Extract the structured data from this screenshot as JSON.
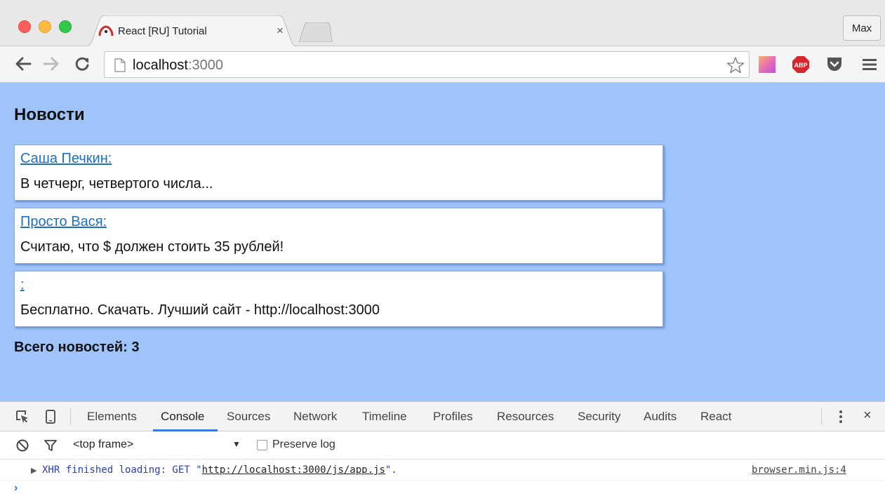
{
  "browser": {
    "tab": {
      "title": "React [RU] Tutorial",
      "close_glyph": "×"
    },
    "profile_name": "Max",
    "address": {
      "host": "localhost",
      "port": ":3000"
    }
  },
  "page": {
    "heading": "Новости",
    "articles": [
      {
        "author": "Саша Печкин:",
        "text": "В четчерг, четвертого числа..."
      },
      {
        "author": "Просто Вася:",
        "text": "Считаю, что $ должен стоить 35 рублей!"
      },
      {
        "author": ":",
        "text": "Бесплатно. Скачать. Лучший сайт - http://localhost:3000"
      }
    ],
    "total": "Всего новостей: 3"
  },
  "devtools": {
    "tabs": [
      "Elements",
      "Console",
      "Sources",
      "Network",
      "Timeline",
      "Profiles",
      "Resources",
      "Security",
      "Audits",
      "React"
    ],
    "active_tab": "Console",
    "close_glyph": "×",
    "frame_select": "<top frame>",
    "preserve_log": "Preserve log",
    "console": {
      "message_prefix": "XHR finished loading: GET \"",
      "message_url": "http://localhost:3000/js/app.js",
      "message_suffix": "\".",
      "source": "browser.min.js:4",
      "prompt": "›"
    }
  },
  "colors": {
    "page_background": "#9ec4fb",
    "link": "#1a6fc8",
    "devtools_active": "#3879d9",
    "abp_red": "#d6262b"
  },
  "icons": {
    "back": "arrow-left-icon",
    "forward": "arrow-right-icon",
    "reload": "reload-icon",
    "bookmark": "star-icon",
    "menu": "hamburger-icon"
  }
}
